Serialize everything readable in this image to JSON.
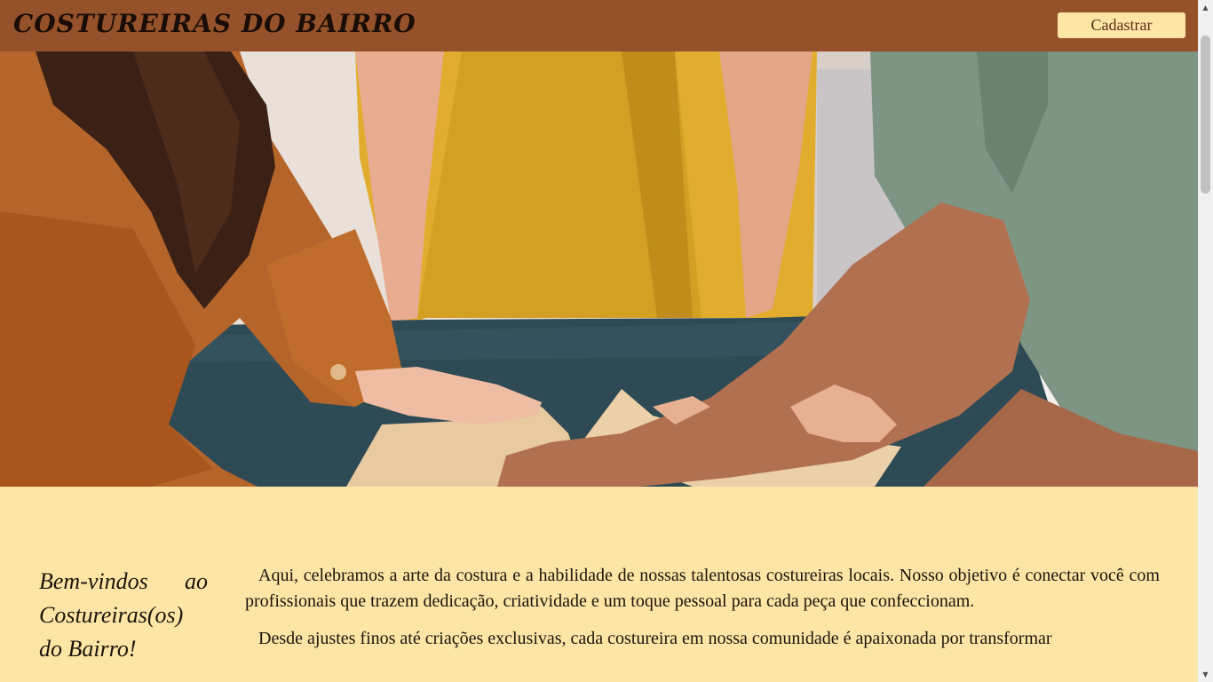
{
  "header": {
    "brand": "COSTUREIRAS DO BAIRRO",
    "signup_label": "Cadastrar"
  },
  "hero": {
    "image": "people-cutting-sewing-pattern-photo"
  },
  "welcome": {
    "title": "Bem-vindos ao Costureiras(os) do Bairro!"
  },
  "intro": {
    "paragraphs": [
      "Aqui, celebramos a arte da costura e a habilidade de nossas talentosas costureiras locais. Nosso objetivo é conectar você com profissionais que trazem dedicação, criatividade e um toque pessoal para cada peça que confeccionam.",
      "Desde ajustes finos até criações exclusivas, cada costureira em nossa comunidade é apaixonada por transformar"
    ]
  },
  "colors": {
    "header_bg": "#95522a",
    "page_bg": "#fde5a6",
    "button_bg": "#fde5a6",
    "button_text": "#5b2b12"
  },
  "icons": {
    "scroll_up": "triangle-up-icon",
    "scroll_down": "triangle-down-icon"
  }
}
